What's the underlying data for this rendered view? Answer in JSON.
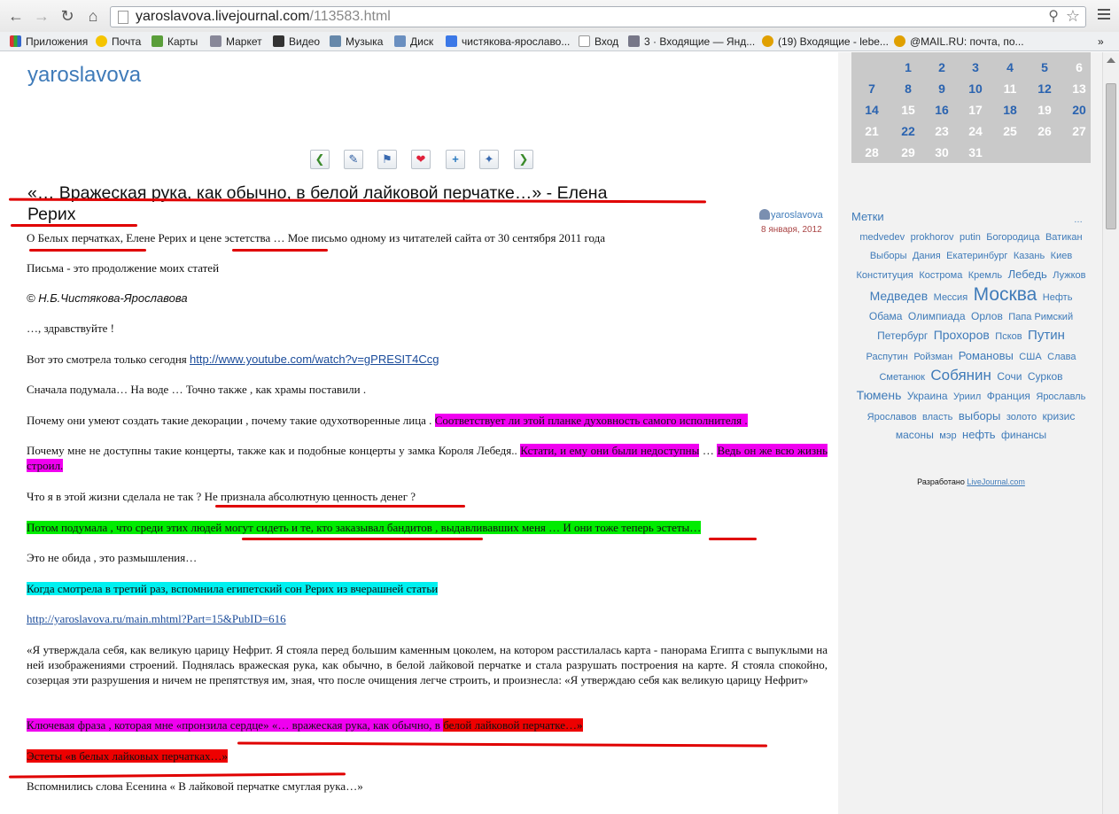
{
  "browser": {
    "url_host": "yaroslavova.livejournal.com",
    "url_path": "/113583.html",
    "bookmarks": [
      "Приложения",
      "Почта",
      "Карты",
      "Маркет",
      "Видео",
      "Музыка",
      "Диск",
      "чистякова-ярославо...",
      "Вход",
      "3 · Входящие — Янд...",
      "(19) Входящие - lebe...",
      "@MAIL.RU: почта, по..."
    ],
    "bookmarks_more": "»"
  },
  "blog": {
    "name": "yaroslavova"
  },
  "post": {
    "title_line1": "«… Вражеская рука, как обычно, в белой лайковой перчатке…» - Елена",
    "title_line2": "Рерих",
    "author": "yaroslavova",
    "date": "8 января, 2012"
  },
  "body": {
    "intro": "О Белых перчатках,  Елене   Рерих   и цене   эстетства … Мое  письмо одному  из читателей  сайта от 30 сентября     2011 года",
    "p1": "Письма   - это продолжение моих статей",
    "p2": "© Н.Б.Чистякова-Ярославова",
    "p3": "…, здравствуйте !",
    "p4_text": "Вот это смотрела только сегодня ",
    "p4_link": "http://www.youtube.com/watch?v=gPRESIT4Ccg",
    "p5": "Сначала подумала… На воде …  Точно также , как храмы поставили .",
    "p6_text": "Почему они умеют создать такие декорации , почему такие одухотворенные лица . ",
    "p6_hl": "Соответствует ли этой планке духовность самого исполнителя .",
    "p7_text": "Почему мне не доступны такие концерты, также как и подобные концерты у замка Короля Лебедя.. ",
    "p7_hl1": "Кстати,  и ему они были недоступны",
    "p7_mid": " … ",
    "p7_hl2": "Ведь он же всю жизнь строил.",
    "p8_text": "Что я в этой жизни сделала не так ? ",
    "p8_u": "Не признала абсолютную ценность денег ?",
    "p9_hl": "Потом подумала , что среди этих людей могут сидеть и те, кто заказывал бандитов , выдавливавших меня   …  И они тоже теперь эстеты…",
    "p10": "Это не обида , это размышления…",
    "p11_hl": "Когда смотрела в третий раз, вспомнила египетский сон Рерих из вчерашней статьи",
    "p12_link": "http://yaroslavova.ru/main.mhtml?Part=15&PubID=616",
    "p13": "«Я утверждала себя, как великую царицу Нефрит. Я стояла перед большим каменным цоколем, на котором расстилалась карта - панорама Египта с выпуклыми на ней изображениями строений. Поднялась вражеская рука, как обычно, в белой лайковой перчатке и стала разрушать построения на карте. Я стояла спокойно, созерцая эти разрушения и ничем не препятствуя им, зная, что после очищения легче строить, и произнесла: «Я утверждаю себя как великую царицу Нефрит»",
    "p14_hl1": "Ключевая фраза , которая мне «пронзила сердце»  «…  вражеская рука, как обычно, в ",
    "p14_hl2": "белой лайковой перчатке…»",
    "p15_hl": "Эстеты «в белых лайковых перчатках…»",
    "p16": "Вспомнились слова Есенина « В лайковой перчатке смуглая рука…»"
  },
  "calendar": {
    "rows": [
      [
        "",
        "1",
        "2",
        "3",
        "4",
        "5",
        "6"
      ],
      [
        "7",
        "8",
        "9",
        "10",
        "11",
        "12",
        "13"
      ],
      [
        "14",
        "15",
        "16",
        "17",
        "18",
        "19",
        "20"
      ],
      [
        "21",
        "22",
        "23",
        "24",
        "25",
        "26",
        "27"
      ],
      [
        "28",
        "29",
        "30",
        "31",
        "",
        "",
        ""
      ]
    ]
  },
  "tags": {
    "heading": "Метки",
    "more": "…",
    "cloud": [
      [
        "medvedev",
        "prokhorov",
        "putin",
        "Богородица",
        "Ватикан"
      ],
      [
        "Выборы",
        "Дания",
        "Екатеринбург",
        "Казань",
        "Киев"
      ],
      [
        "Конституция",
        "Кострома",
        "Кремль",
        "Лебедь",
        "Лужков"
      ],
      [
        "Медведев",
        "Мессия",
        "Москва",
        "Нефть"
      ],
      [
        "Обама",
        "Олимпиада",
        "Орлов",
        "Папа Римский"
      ],
      [
        "Петербург",
        "Прохоров",
        "Псков",
        "Путин"
      ],
      [
        "Распутин",
        "Ройзман",
        "Романовы",
        "США",
        "Слава"
      ],
      [
        "Сметанюк",
        "Собянин",
        "Сочи",
        "Сурков"
      ],
      [
        "Тюмень",
        "Украина",
        "Уриил",
        "Франция",
        "Ярославль"
      ],
      [
        "Ярославов",
        "власть",
        "выборы",
        "золото",
        "кризис"
      ],
      [
        "масоны",
        "мэр",
        "нефть",
        "финансы"
      ]
    ]
  },
  "footer": {
    "credit_text": "Разработано",
    "credit_link": "LiveJournal.com"
  },
  "colors": {
    "link": "#3f7bb9",
    "highlight_magenta": "#f000f0",
    "highlight_green": "#00ec00",
    "highlight_cyan": "#00f0f0",
    "highlight_red": "#ee0000",
    "underline_red": "#e00000"
  }
}
